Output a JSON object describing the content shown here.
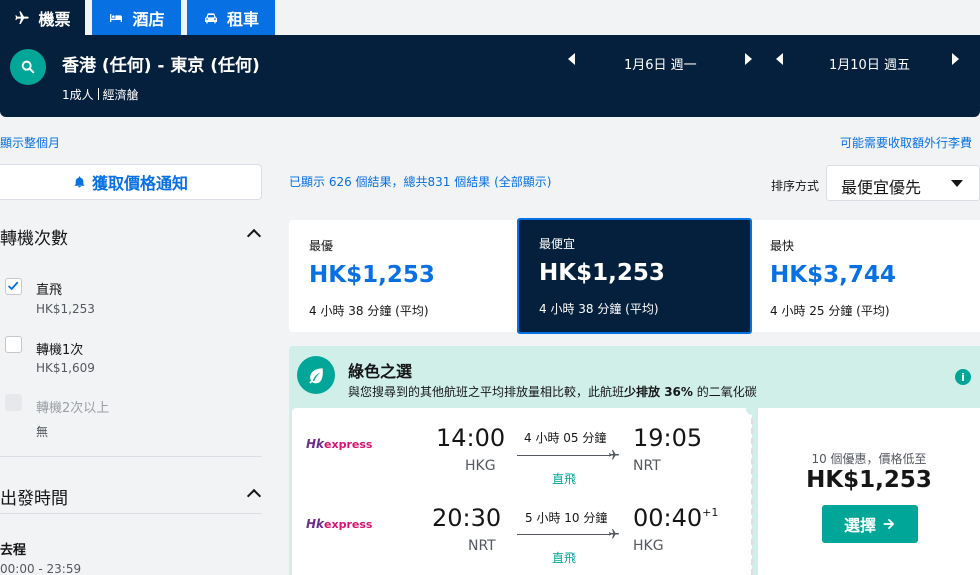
{
  "tabs": [
    {
      "label": "機票",
      "icon": "plane-icon",
      "active": true
    },
    {
      "label": "酒店",
      "icon": "bed-icon",
      "active": false
    },
    {
      "label": "租車",
      "icon": "car-icon",
      "active": false
    }
  ],
  "header": {
    "route": "香港 (任何) - 東京 (任何)",
    "passengers": "1成人",
    "cabin": "經濟艙",
    "depart_date": "1月6日 週一",
    "return_date": "1月10日 週五"
  },
  "links": {
    "show_month": "顯示整個月",
    "extra_fees": "可能需要收取額外行李費"
  },
  "sidebar": {
    "price_alert": "獲取價格通知",
    "stops_title": "轉機次數",
    "stops": [
      {
        "label": "直飛",
        "price": "HK$1,253",
        "checked": true,
        "disabled": false
      },
      {
        "label": "轉機1次",
        "price": "HK$1,609",
        "checked": false,
        "disabled": false
      },
      {
        "label": "轉機2次以上",
        "price": "無",
        "checked": false,
        "disabled": true
      }
    ],
    "depart_time_title": "出發時間",
    "outbound_label": "去程",
    "outbound_range": "00:00 - 23:59"
  },
  "results": {
    "count_text": "已顯示 626 個結果，總共831 個結果 (全部顯示)",
    "sort_label": "排序方式",
    "sort_value": "最便宜優先"
  },
  "price_tabs": [
    {
      "title": "最優",
      "price": "HK$1,253",
      "duration": "4 小時 38 分鐘 (平均)",
      "active": false
    },
    {
      "title": "最便宜",
      "price": "HK$1,253",
      "duration": "4 小時 38 分鐘 (平均)",
      "active": true
    },
    {
      "title": "最快",
      "price": "HK$3,744",
      "duration": "4 小時 25 分鐘 (平均)",
      "active": false
    }
  ],
  "green_choice": {
    "title": "綠色之選",
    "desc_prefix": "與您搜尋到的其他航班之平均排放量相比較，此航班",
    "desc_bold": "少排放 36%",
    "desc_suffix": " 的二氧化碳",
    "info": "i"
  },
  "flight": {
    "legs": [
      {
        "airline_hk": "Hk",
        "airline_rest": "express",
        "dep_time": "14:00",
        "dep_code": "HKG",
        "duration": "4 小時 05 分鐘",
        "stops": "直飛",
        "arr_time": "19:05",
        "arr_code": "NRT",
        "day_offset": ""
      },
      {
        "airline_hk": "Hk",
        "airline_rest": "express",
        "dep_time": "20:30",
        "dep_code": "NRT",
        "duration": "5 小時 10 分鐘",
        "stops": "直飛",
        "arr_time": "00:40",
        "arr_code": "HKG",
        "day_offset": "+1"
      }
    ],
    "deals_text": "10 個優惠，價格低至",
    "price": "HK$1,253",
    "select_label": "選擇"
  },
  "colors": {
    "navy": "#05203c",
    "blue": "#0770e3",
    "teal": "#00a698",
    "green_bg": "#d1efe9"
  }
}
